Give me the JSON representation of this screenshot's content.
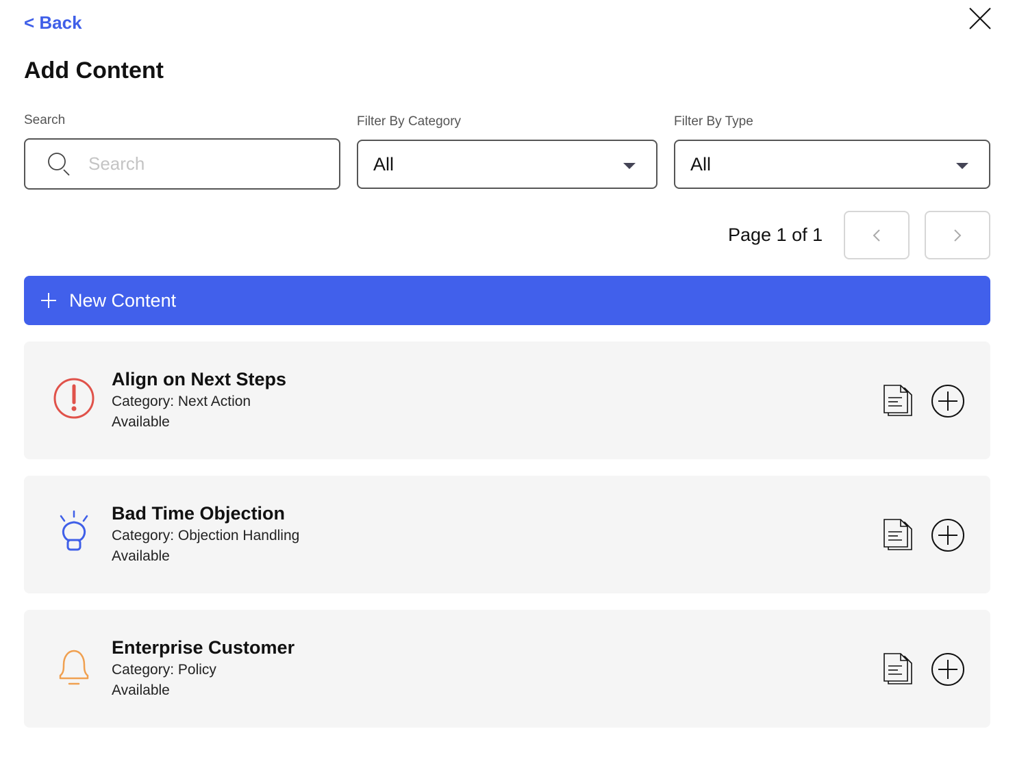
{
  "nav": {
    "back_label": "< Back"
  },
  "header": {
    "title": "Add Content"
  },
  "filters": {
    "search_label": "Search",
    "search_placeholder": "Search",
    "search_value": "",
    "category_label": "Filter By Category",
    "category_value": "All",
    "type_label": "Filter By Type",
    "type_value": "All"
  },
  "pagination": {
    "text": "Page 1 of 1",
    "current_page": 1,
    "total_pages": 1
  },
  "actions": {
    "new_content_label": "New Content"
  },
  "content_items": [
    {
      "title": "Align on Next Steps",
      "category": "Category: Next Action",
      "status": "Available",
      "icon": "alert-circle-icon",
      "icon_color": "#e0524a"
    },
    {
      "title": "Bad Time Objection",
      "category": "Category: Objection Handling",
      "status": "Available",
      "icon": "lightbulb-icon",
      "icon_color": "#3f5fe8"
    },
    {
      "title": "Enterprise Customer",
      "category": "Category: Policy",
      "status": "Available",
      "icon": "bell-icon",
      "icon_color": "#f0a050"
    }
  ],
  "colors": {
    "accent": "#4160eb",
    "link": "#3f5fe8",
    "card_bg": "#f5f5f5"
  }
}
